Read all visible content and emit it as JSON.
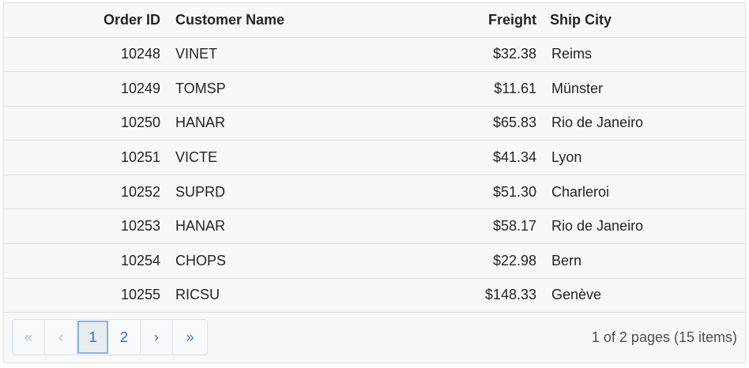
{
  "columns": {
    "order_id": "Order ID",
    "customer_name": "Customer Name",
    "freight": "Freight",
    "ship_city": "Ship City"
  },
  "rows": [
    {
      "order_id": "10248",
      "customer_name": "VINET",
      "freight": "$32.38",
      "ship_city": "Reims"
    },
    {
      "order_id": "10249",
      "customer_name": "TOMSP",
      "freight": "$11.61",
      "ship_city": "Münster"
    },
    {
      "order_id": "10250",
      "customer_name": "HANAR",
      "freight": "$65.83",
      "ship_city": "Rio de Janeiro"
    },
    {
      "order_id": "10251",
      "customer_name": "VICTE",
      "freight": "$41.34",
      "ship_city": "Lyon"
    },
    {
      "order_id": "10252",
      "customer_name": "SUPRD",
      "freight": "$51.30",
      "ship_city": "Charleroi"
    },
    {
      "order_id": "10253",
      "customer_name": "HANAR",
      "freight": "$58.17",
      "ship_city": "Rio de Janeiro"
    },
    {
      "order_id": "10254",
      "customer_name": "CHOPS",
      "freight": "$22.98",
      "ship_city": "Bern"
    },
    {
      "order_id": "10255",
      "customer_name": "RICSU",
      "freight": "$148.33",
      "ship_city": "Genève"
    }
  ],
  "pager": {
    "first_label": "«",
    "prev_label": "‹",
    "pages": [
      "1",
      "2"
    ],
    "current_page": "1",
    "next_label": "›",
    "last_label": "»",
    "info": "1 of 2 pages (15 items)"
  },
  "colors": {
    "link": "#2f6fd0",
    "disabled": "#a8c0e0",
    "active_border": "#8ab4ec",
    "border": "#dee2e6"
  }
}
